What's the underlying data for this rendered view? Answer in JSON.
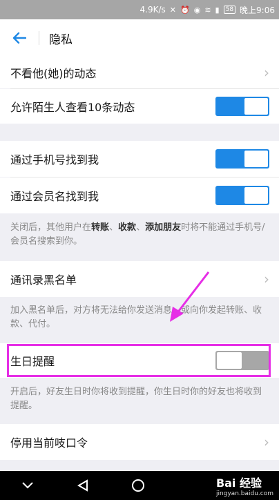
{
  "status": {
    "speed": "4.9K/s",
    "battery": "58",
    "time": "晚上9:06"
  },
  "header": {
    "title": "隐私"
  },
  "rows": {
    "hide_feed": "不看他(她)的动态",
    "stranger_feed": "允许陌生人查看10条动态",
    "find_by_phone": "通过手机号找到我",
    "find_by_member": "通过会员名找到我",
    "blacklist": "通讯录黑名单",
    "birthday": "生日提醒",
    "disable_code": "停用当前吱口令"
  },
  "notes": {
    "find_note_pre": "关闭后，其他用户在",
    "find_note_b1": "转账",
    "find_note_sep1": "、",
    "find_note_b2": "收款",
    "find_note_sep2": "、",
    "find_note_b3": "添加朋友",
    "find_note_post": "时将不能通过手机号/会员名搜索到你。",
    "blacklist_note": "加入黑名单后，对方将无法给你发送消息，或向你发起转账、收款、代付。",
    "birthday_note": "开启后，好友生日时你将收到提醒，你生日时你的好友也将收到提醒。"
  },
  "toggles": {
    "stranger_feed": "on",
    "find_by_phone": "on",
    "find_by_member": "on",
    "birthday": "off"
  },
  "watermark": {
    "brand": "Bai 经验",
    "url": "jingyan.baidu.com"
  },
  "colors": {
    "accent": "#1e88e5",
    "highlight": "#e62ee6"
  }
}
